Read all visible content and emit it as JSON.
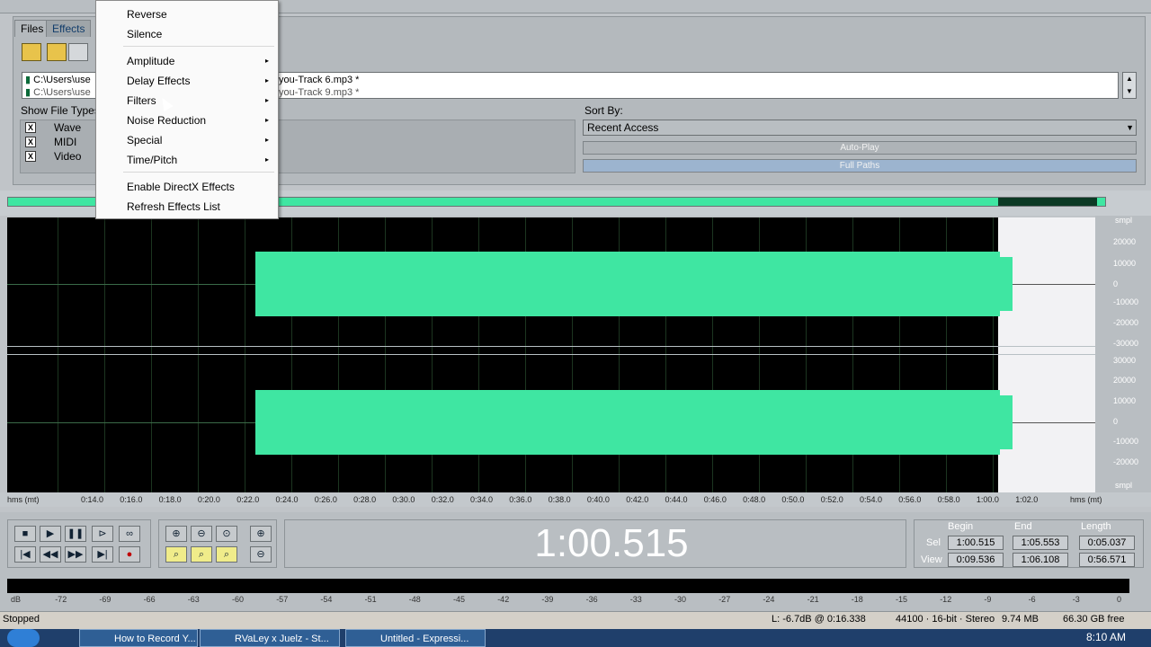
{
  "context_menu": {
    "items": [
      {
        "label": "Reverse",
        "submenu": false
      },
      {
        "label": "Silence",
        "submenu": false
      },
      {
        "label": "Amplitude",
        "submenu": true
      },
      {
        "label": "Delay Effects",
        "submenu": true
      },
      {
        "label": "Filters",
        "submenu": true
      },
      {
        "label": "Noise Reduction",
        "submenu": true
      },
      {
        "label": "Special",
        "submenu": true
      },
      {
        "label": "Time/Pitch",
        "submenu": true
      },
      {
        "label": "Enable DirectX Effects",
        "submenu": false
      },
      {
        "label": "Refresh Effects List",
        "submenu": false
      }
    ],
    "arrow": "▸"
  },
  "tabs": {
    "files": "Files",
    "effects": "Effects"
  },
  "files": {
    "rows": [
      {
        "left": "C:\\Users\\use",
        "right": "you-Track 6.mp3 *"
      },
      {
        "left": "C:\\Users\\use",
        "right": "you-Track 9.mp3 *"
      }
    ],
    "show_file_types_label": "Show File Types:",
    "types": [
      {
        "label": "Wave",
        "checked": "X"
      },
      {
        "label": "MIDI",
        "checked": "X"
      },
      {
        "label": "Video",
        "checked": "X"
      }
    ],
    "sort_by_label": "Sort By:",
    "sort_by_value": "Recent Access",
    "auto_play": "Auto-Play",
    "full_paths": "Full Paths"
  },
  "waveform": {
    "y_unit": "smpl",
    "y_labels_top": [
      "20000",
      "10000",
      "0",
      "-10000",
      "-20000",
      "-30000"
    ],
    "y_labels_bottom": [
      "30000",
      "20000",
      "10000",
      "0",
      "-10000",
      "-20000"
    ],
    "x_left_label": "hms (mt)",
    "x_right_label": "hms (mt)",
    "x_ticks": [
      "0:14.0",
      "0:16.0",
      "0:18.0",
      "0:20.0",
      "0:22.0",
      "0:24.0",
      "0:26.0",
      "0:28.0",
      "0:30.0",
      "0:32.0",
      "0:34.0",
      "0:36.0",
      "0:38.0",
      "0:40.0",
      "0:42.0",
      "0:44.0",
      "0:46.0",
      "0:48.0",
      "0:50.0",
      "0:52.0",
      "0:54.0",
      "0:56.0",
      "0:58.0",
      "1:00.0",
      "1:02.0"
    ],
    "colors": {
      "wave": "#3fe6a2",
      "background": "#000000",
      "selection": "#f2f2f4"
    }
  },
  "transport": {
    "time": "1:00.515"
  },
  "selection": {
    "headers": {
      "begin": "Begin",
      "end": "End",
      "length": "Length"
    },
    "sel_label": "Sel",
    "view_label": "View",
    "sel": {
      "begin": "1:00.515",
      "end": "1:05.553",
      "length": "0:05.037"
    },
    "view": {
      "begin": "0:09.536",
      "end": "1:06.108",
      "length": "0:56.571"
    }
  },
  "meter": {
    "ticks": [
      "dB",
      "-72",
      "-69",
      "-66",
      "-63",
      "-60",
      "-57",
      "-54",
      "-51",
      "-48",
      "-45",
      "-42",
      "-39",
      "-36",
      "-33",
      "-30",
      "-27",
      "-24",
      "-21",
      "-18",
      "-15",
      "-12",
      "-9",
      "-6",
      "-3",
      "0"
    ]
  },
  "status": {
    "state": "Stopped",
    "level": "L: -6.7dB @  0:16.338",
    "format": "44100 · 16-bit · Stereo",
    "size": "9.74 MB",
    "free": "66.30 GB free"
  },
  "taskbar": {
    "buttons": [
      "How to Record Y...",
      "RVaLey x Juelz - St...",
      "Untitled - Expressi..."
    ],
    "clock": "8:10 AM"
  }
}
